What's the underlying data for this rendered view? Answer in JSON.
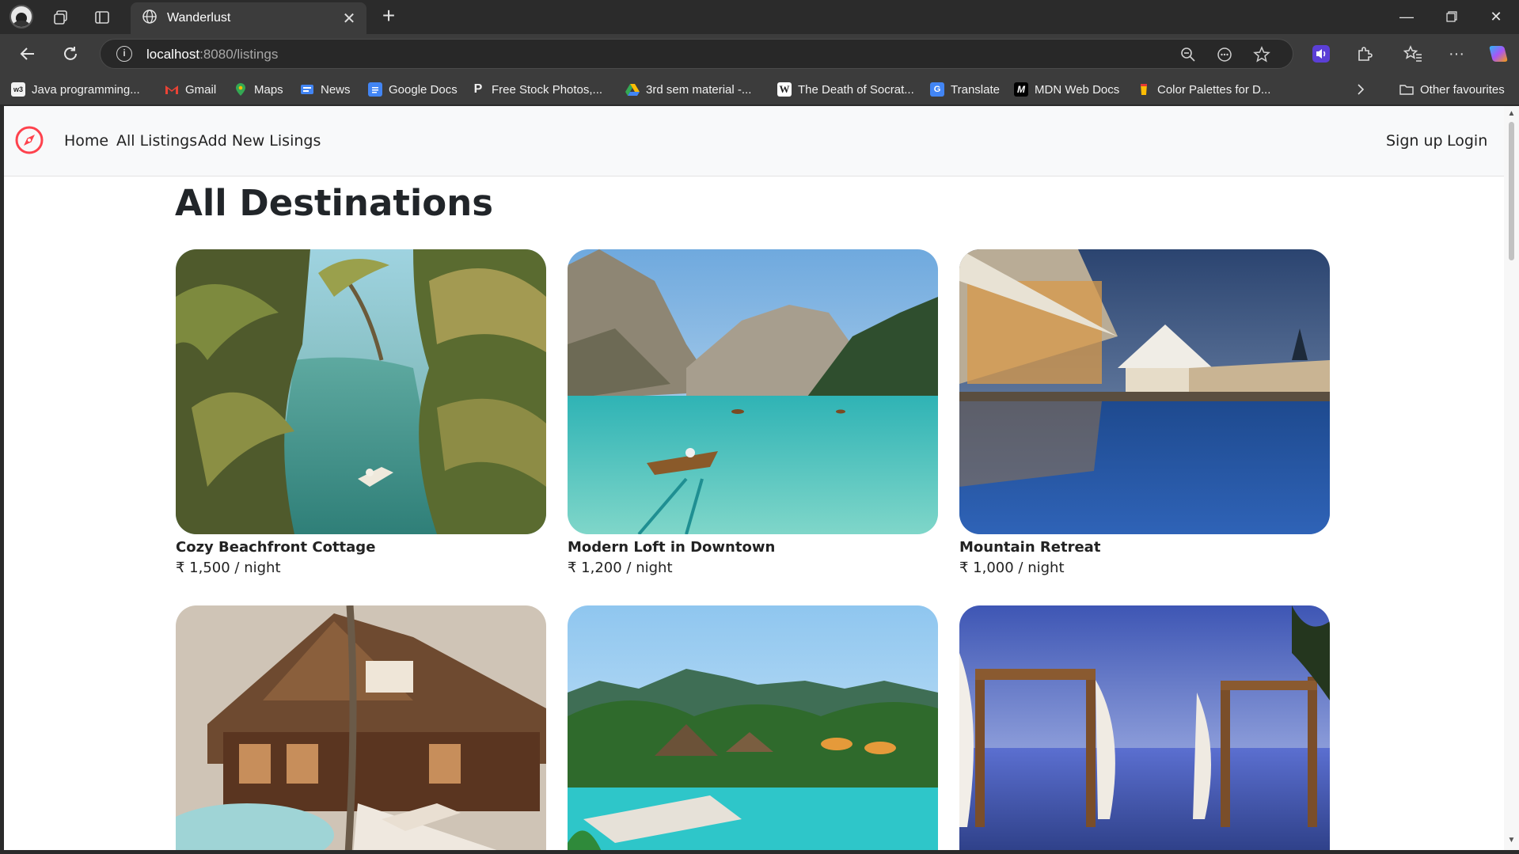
{
  "browser": {
    "tab_title": "Wanderlust",
    "url_host": "localhost",
    "url_path": ":8080/listings",
    "bookmarks": [
      {
        "label": "Java programming...",
        "icon": "w3schools-icon"
      },
      {
        "label": "Gmail",
        "icon": "gmail-icon"
      },
      {
        "label": "Maps",
        "icon": "maps-icon"
      },
      {
        "label": "News",
        "icon": "news-icon"
      },
      {
        "label": "Google Docs",
        "icon": "docs-icon"
      },
      {
        "label": "Free Stock Photos,...",
        "icon": "pexels-icon"
      },
      {
        "label": "3rd sem material -...",
        "icon": "drive-icon"
      },
      {
        "label": "The Death of Socrat...",
        "icon": "wikipedia-icon"
      },
      {
        "label": "Translate",
        "icon": "translate-icon"
      },
      {
        "label": "MDN Web Docs",
        "icon": "mdn-icon"
      },
      {
        "label": "Color Palettes for D...",
        "icon": "coolors-icon"
      }
    ],
    "other_favourites": "Other favourites"
  },
  "site": {
    "nav": {
      "home": "Home",
      "all_listings": "All Listings",
      "add_new": "Add New Lisings",
      "signup": "Sign up",
      "login": "Login"
    },
    "brand_color": "#fe424d",
    "page_title": "All Destinations",
    "listings": [
      {
        "title": "Cozy Beachfront Cottage",
        "price": "₹ 1,500 / night",
        "image": "tropical-river-palms"
      },
      {
        "title": "Modern Loft in Downtown",
        "price": "₹ 1,200 / night",
        "image": "alpine-lake-boat"
      },
      {
        "title": "Mountain Retreat",
        "price": "₹ 1,000 / night",
        "image": "resort-pool-dusk"
      },
      {
        "title": "",
        "price": "",
        "image": "wooden-lodge-pool"
      },
      {
        "title": "",
        "price": "",
        "image": "tropical-resort-pool"
      },
      {
        "title": "",
        "price": "",
        "image": "cabana-infinity-pool"
      }
    ]
  }
}
